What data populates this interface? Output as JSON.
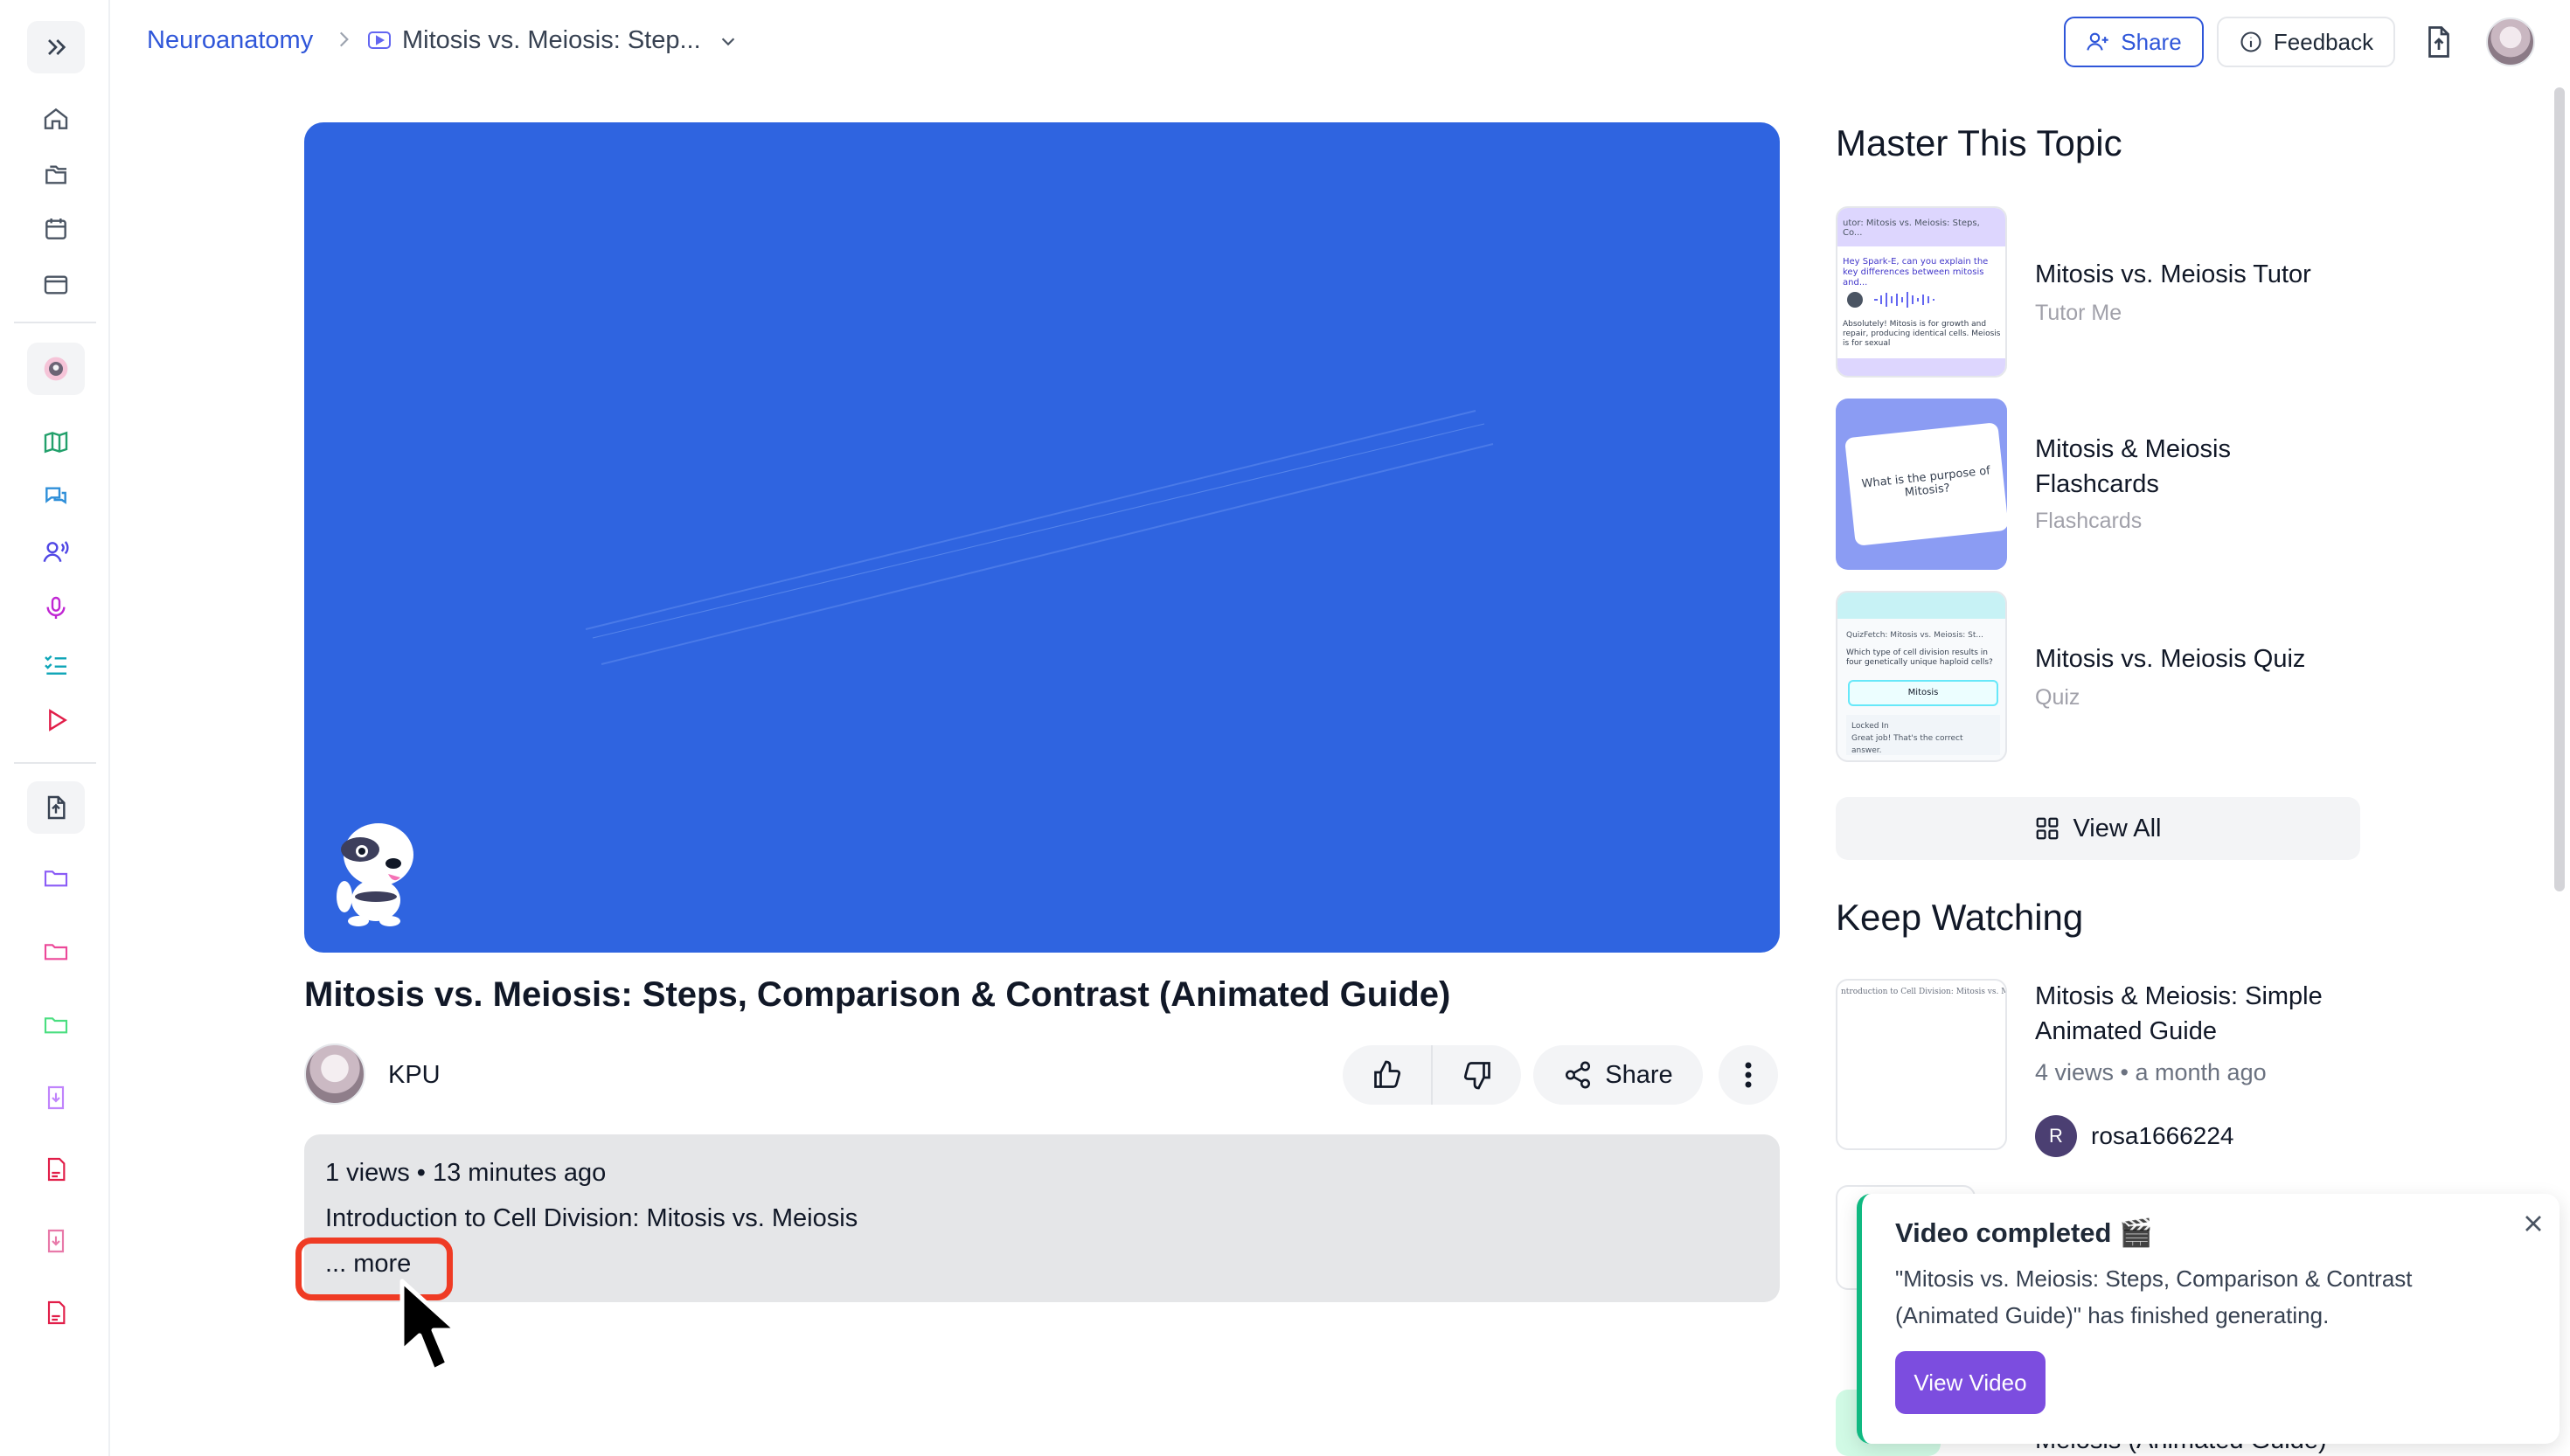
{
  "breadcrumb": {
    "root": "Neuroanatomy",
    "current": "Mitosis vs. Meiosis: Step..."
  },
  "header": {
    "share_label": "Share",
    "feedback_label": "Feedback"
  },
  "video": {
    "title": "Mitosis vs. Meiosis: Steps, Comparison & Contrast (Animated Guide)",
    "channel": "KPU",
    "share_label": "Share",
    "meta": "1 views  •  13 minutes ago",
    "description": "Introduction to Cell Division: Mitosis vs. Meiosis",
    "more_label": "... more"
  },
  "master": {
    "heading": "Master This Topic",
    "items": [
      {
        "title": "Mitosis vs. Meiosis Tutor",
        "subtitle": "Tutor Me",
        "thumb_bar": "utor: Mitosis vs. Meiosis: Steps, Co...",
        "thumb_q": "Hey Spark-E, can you explain the key differences between mitosis and...",
        "thumb_a": "Absolutely! Mitosis is for growth and repair, producing identical cells. Meiosis is for sexual"
      },
      {
        "title_line1": "Mitosis & Meiosis",
        "title_line2": "Flashcards",
        "subtitle": "Flashcards",
        "thumb_card": "What is the purpose of Mitosis?"
      },
      {
        "title": "Mitosis vs. Meiosis Quiz",
        "subtitle": "Quiz",
        "thumb_head": "QuizFetch: Mitosis vs. Meiosis: St...",
        "thumb_q": "Which type of cell division results in four genetically unique haploid cells?",
        "thumb_ans": "Mitosis",
        "thumb_locked": "Locked In",
        "thumb_feedback": "Great job! That's the correct answer."
      }
    ],
    "view_all_label": "View All"
  },
  "keep_watching": {
    "heading": "Keep Watching",
    "items": [
      {
        "title_line1": "Mitosis & Meiosis: Simple",
        "title_line2": "Animated Guide",
        "meta": "4 views • a month ago",
        "author_initial": "R",
        "author": "rosa1666224",
        "thumb_text": "ntroduction to Cell Division: Mitosis vs. Meios"
      }
    ],
    "peek_title": "Meiosis (Animated Guide)"
  },
  "toast": {
    "title": "Video completed 🎬",
    "body": "\"Mitosis vs. Meiosis: Steps, Comparison & Contrast (Animated Guide)\" has finished generating.",
    "button_label": "View Video"
  },
  "colors": {
    "accent": "#2f56d9",
    "video_bg": "#2f64e0",
    "toast_button": "#7c4ddf",
    "highlight": "#ef3b24"
  }
}
